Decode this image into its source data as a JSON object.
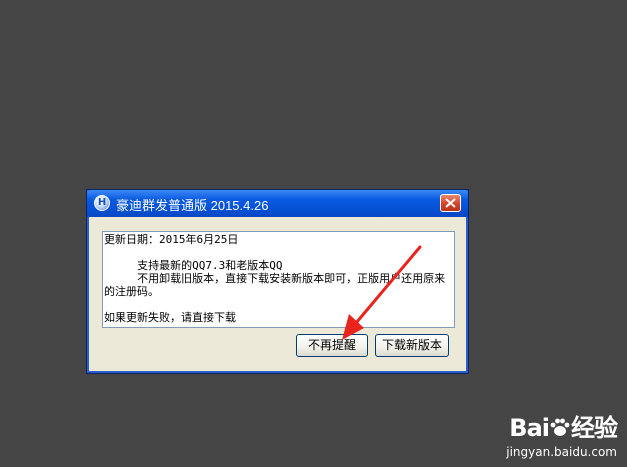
{
  "dialog": {
    "title": "豪迪群发普通版 2015.4.26",
    "icon": "H",
    "close_icon": "close-icon",
    "content_lines": [
      "更新日期：2015年6月25日",
      "",
      "     支持最新的QQ7.3和老版本QQ",
      "     不用卸载旧版本，直接下载安装新版本即可，正版用户还用原来的注册码。",
      "",
      "如果更新失败，请直接下载"
    ],
    "buttons": {
      "no_remind": "不再提醒",
      "download": "下载新版本"
    }
  },
  "watermark": {
    "logo_left": "Bai",
    "logo_right": "经验",
    "url": "jingyan.baidu.com"
  },
  "colors": {
    "background": "#454545",
    "titlebar": "#0551d6",
    "arrow": "#e8241c"
  }
}
